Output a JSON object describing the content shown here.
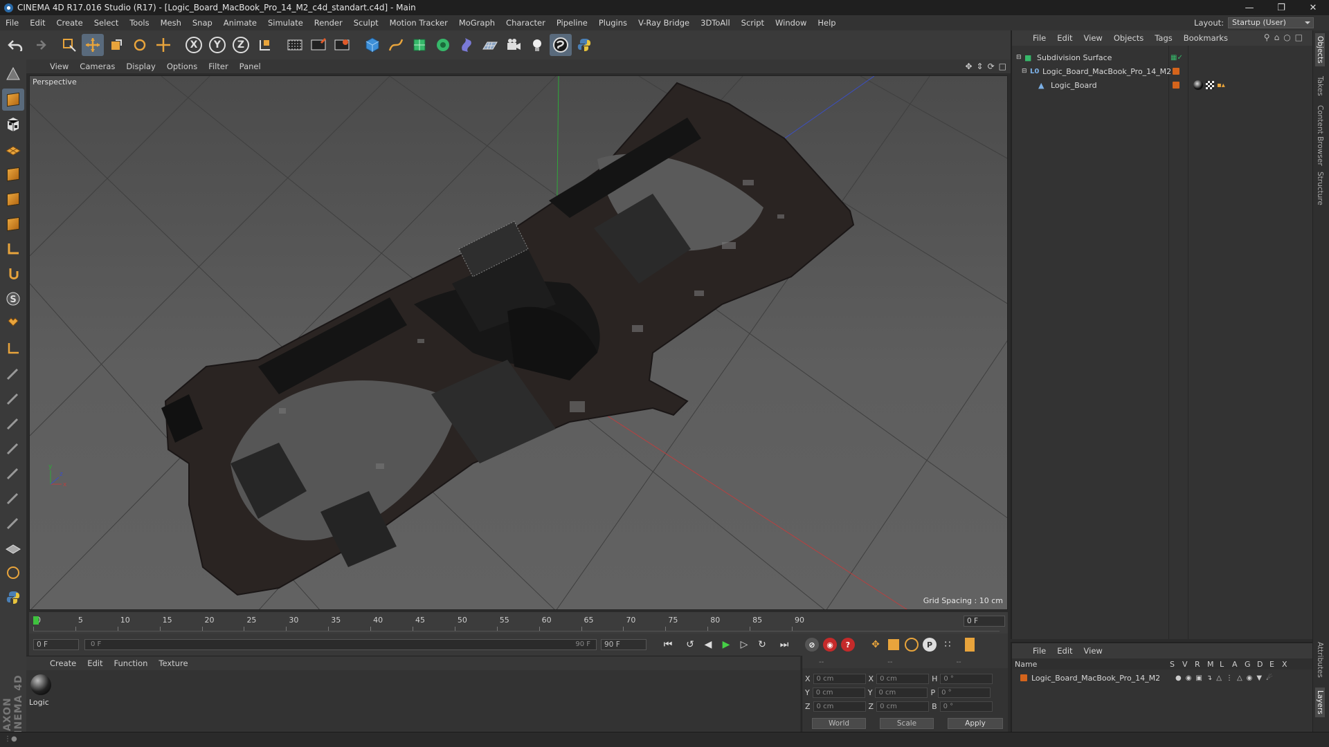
{
  "window": {
    "title": "CINEMA 4D R17.016 Studio (R17) - [Logic_Board_MacBook_Pro_14_M2_c4d_standart.c4d] - Main"
  },
  "menu": [
    "File",
    "Edit",
    "Create",
    "Select",
    "Tools",
    "Mesh",
    "Snap",
    "Animate",
    "Simulate",
    "Render",
    "Sculpt",
    "Motion Tracker",
    "MoGraph",
    "Character",
    "Pipeline",
    "Plugins",
    "V-Ray Bridge",
    "3DToAll",
    "Script",
    "Window",
    "Help"
  ],
  "layout": {
    "label": "Layout:",
    "value": "Startup (User)"
  },
  "axis_buttons": [
    "X",
    "Y",
    "Z"
  ],
  "viewport": {
    "menu": [
      "View",
      "Cameras",
      "Display",
      "Options",
      "Filter",
      "Panel"
    ],
    "label": "Perspective",
    "grid_spacing": "Grid Spacing : 10 cm",
    "axis_gizmo": {
      "x": "x",
      "y": "y",
      "z": "z"
    }
  },
  "timeline": {
    "ticks": [
      "0",
      "5",
      "10",
      "15",
      "20",
      "25",
      "30",
      "35",
      "40",
      "45",
      "50",
      "55",
      "60",
      "65",
      "70",
      "75",
      "80",
      "85",
      "90"
    ],
    "current_frame": "0 F"
  },
  "transport": {
    "start_field": "0 F",
    "range_start": "0 F",
    "range_end": "90 F",
    "end_field": "90 F"
  },
  "material_manager": {
    "menu": [
      "Create",
      "Edit",
      "Function",
      "Texture"
    ],
    "materials": [
      {
        "name": "Logic"
      }
    ]
  },
  "coordinates": {
    "header": [
      "--",
      "--",
      "--"
    ],
    "rows": [
      {
        "a": "X",
        "av": "0 cm",
        "b": "X",
        "bv": "0 cm",
        "c": "H",
        "cv": "0 °"
      },
      {
        "a": "Y",
        "av": "0 cm",
        "b": "Y",
        "bv": "0 cm",
        "c": "P",
        "cv": "0 °"
      },
      {
        "a": "Z",
        "av": "0 cm",
        "b": "Z",
        "bv": "0 cm",
        "c": "B",
        "cv": "0 °"
      }
    ],
    "mode": "World",
    "scale": "Scale",
    "apply": "Apply"
  },
  "object_manager": {
    "menu": [
      "File",
      "Edit",
      "View",
      "Objects",
      "Tags",
      "Bookmarks"
    ],
    "objects": [
      {
        "name": "Subdivision Surface"
      },
      {
        "name": "Logic_Board_MacBook_Pro_14_M2"
      },
      {
        "name": "Logic_Board"
      }
    ]
  },
  "layer_manager": {
    "menu": [
      "File",
      "Edit",
      "View"
    ],
    "columns": [
      "Name",
      "S",
      "V",
      "R",
      "M",
      "L",
      "A",
      "G",
      "D",
      "E",
      "X"
    ],
    "layers": [
      {
        "name": "Logic_Board_MacBook_Pro_14_M2"
      }
    ]
  },
  "right_tabs": [
    "Objects",
    "Takes",
    "Content Browser",
    "Structure",
    "Attributes",
    "Layers"
  ],
  "branding": "MAXON CINEMA 4D",
  "colors": {
    "accent": "#596a7c",
    "layer_color": "#d4641c",
    "play": "#46d046"
  }
}
